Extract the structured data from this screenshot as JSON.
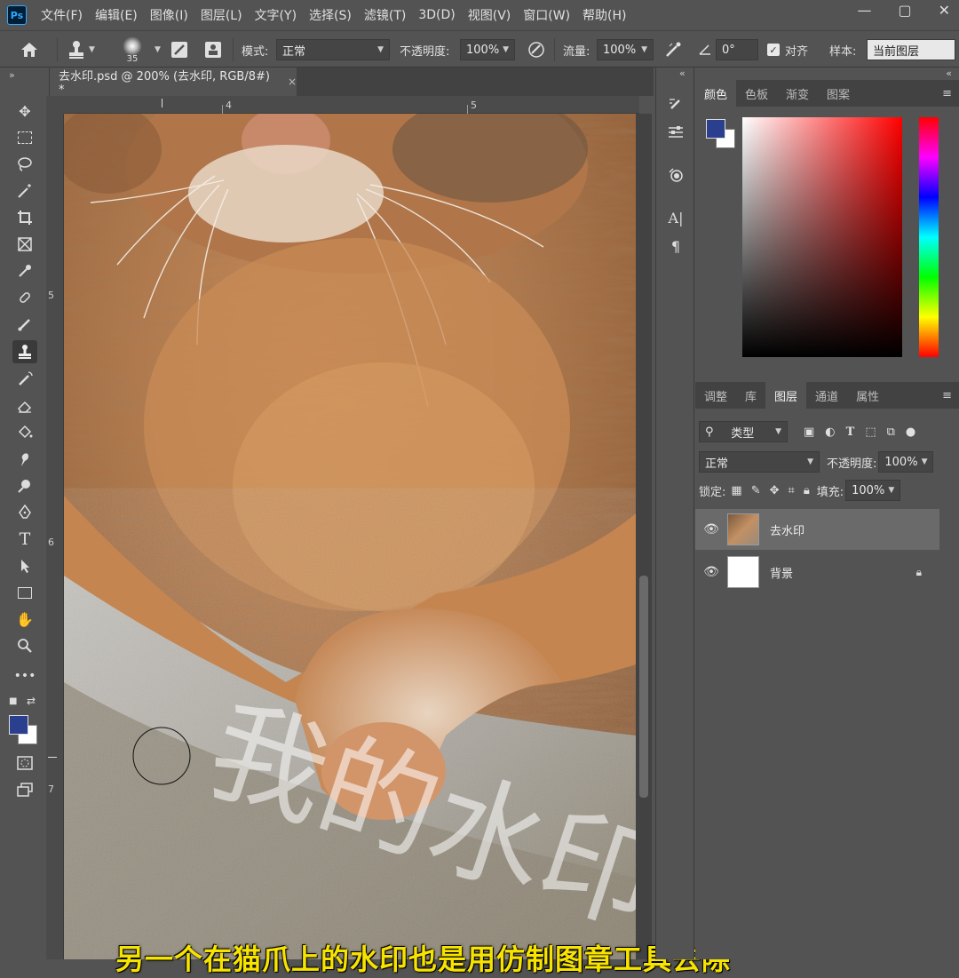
{
  "app": {
    "logo_text": "Ps",
    "menu": [
      "文件(F)",
      "编辑(E)",
      "图像(I)",
      "图层(L)",
      "文字(Y)",
      "选择(S)",
      "滤镜(T)",
      "3D(D)",
      "视图(V)",
      "窗口(W)",
      "帮助(H)"
    ],
    "win_controls": [
      "—",
      "▢",
      "✕"
    ]
  },
  "options": {
    "brush_size": "35",
    "mode_label": "模式:",
    "mode_value": "正常",
    "opacity_label": "不透明度:",
    "opacity_value": "100%",
    "flow_label": "流量:",
    "flow_value": "100%",
    "angle_value": "0°",
    "align_label": "对齐",
    "sample_label": "样本:",
    "sample_value": "当前图层"
  },
  "document": {
    "tab_title": "去水印.psd @ 200% (去水印, RGB/8#) *",
    "close": "×",
    "ruler_top": [
      "4",
      "5"
    ],
    "ruler_left": [
      "5",
      "6",
      "7"
    ],
    "watermark_text": "我的水印"
  },
  "subtitle": "另一个在猫爪上的水印也是用仿制图章工具去除",
  "colors": {
    "foreground": "#2b3f8f",
    "background": "#ffffff",
    "subtitle": "#f7e300"
  },
  "color_panel": {
    "tabs": [
      "颜色",
      "色板",
      "渐变",
      "图案"
    ],
    "active_tab": "颜色"
  },
  "layers_panel": {
    "tabs": [
      "调整",
      "库",
      "图层",
      "通道",
      "属性"
    ],
    "active_tab": "图层",
    "filter_label": "类型",
    "blend_mode": "正常",
    "opacity_label": "不透明度:",
    "opacity_value": "100%",
    "lock_label": "锁定:",
    "fill_label": "填充:",
    "fill_value": "100%",
    "layers": [
      {
        "name": "去水印",
        "selected": true,
        "locked": false
      },
      {
        "name": "背景",
        "selected": false,
        "locked": true
      }
    ]
  }
}
